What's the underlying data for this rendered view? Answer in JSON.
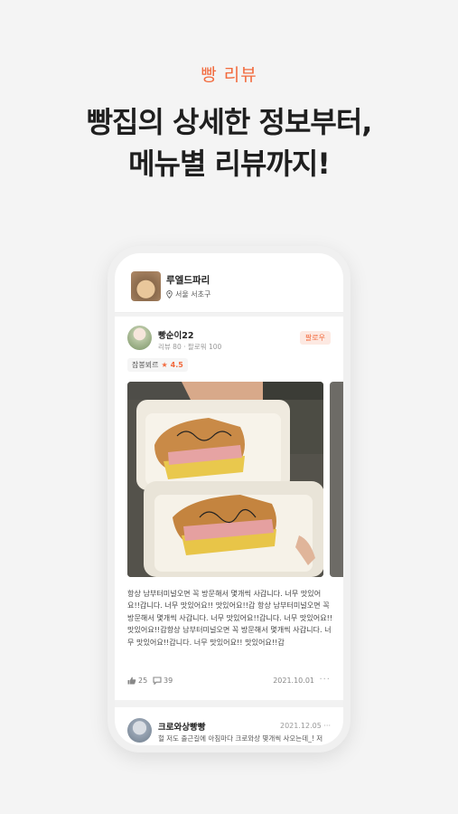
{
  "hero": {
    "tag": "빵 리뷰",
    "title_line1": "빵집의 상세한 정보부터,",
    "title_line2": "메뉴별 리뷰까지!"
  },
  "bakery": {
    "name": "루엘드파리",
    "location": "서울 서초구",
    "location_icon": "pin-icon"
  },
  "review": {
    "user": "빵순이22",
    "stats": "리뷰 80 · 팔로워 100",
    "follow_label": "팔로우",
    "menu": "잠봉뵈르",
    "rating": "4.5",
    "text": "항상 남부터미널오면 꼭 방문해서 몇개씩 사갑니다. 너무 맛있어요!!갑니다. 너무 맛있어요!! 맛있어요!!갑 항상 남부터미널오면 꼭 방문해서 몇개씩 사갑니다. 너무 맛있어요!!갑니다. 너무 맛있어요!! 맛있어요!!갑항상 남부터미널오면 꼭 방문해서 몇개씩 사갑니다. 너무 맛있어요!!갑니다. 너무 맛있어요!! 맛있어요!!갑",
    "likes": "25",
    "comments": "39",
    "date": "2021.10.01",
    "more": "···"
  },
  "review2": {
    "user": "크로와상빵빵",
    "date": "2021.12.05",
    "more": "···",
    "preview": "헐 저도 출근길에 아침마다 크로와상 몇개씩 사오는데_! 저"
  },
  "colors": {
    "accent": "#f26a3d",
    "background": "#f4f4f4"
  }
}
